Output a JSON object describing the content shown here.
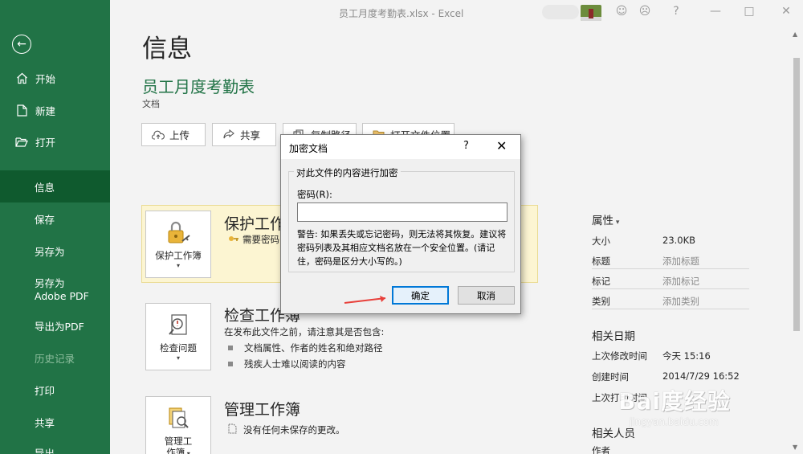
{
  "window": {
    "title": "员工月度考勤表.xlsx - Excel"
  },
  "sidebar": {
    "items": [
      {
        "label": "开始",
        "icon": "home-icon"
      },
      {
        "label": "新建",
        "icon": "new-file-icon"
      },
      {
        "label": "打开",
        "icon": "open-folder-icon"
      },
      {
        "label": "信息",
        "active": true
      },
      {
        "label": "保存"
      },
      {
        "label": "另存为"
      },
      {
        "label": "另存为 Adobe PDF"
      },
      {
        "label": "导出为PDF"
      },
      {
        "label": "历史记录",
        "disabled": true
      },
      {
        "label": "打印"
      },
      {
        "label": "共享"
      },
      {
        "label": "导出"
      }
    ]
  },
  "main": {
    "page_title": "信息",
    "doc_name": "员工月度考勤表",
    "doc_type": "文档",
    "actions": [
      "上传",
      "共享",
      "复制路径",
      "打开文件位置"
    ],
    "protect": {
      "button_label": "保护工作簿",
      "title": "保护工作",
      "desc": "需要密码"
    },
    "inspect": {
      "button_label": "检查问题",
      "title": "检查工作簿",
      "desc": "在发布此文件之前，请注意其是否包含:",
      "bullets": [
        "文档属性、作者的姓名和绝对路径",
        "残疾人士难以阅读的内容"
      ]
    },
    "manage": {
      "button_label_1": "管理工",
      "button_label_2": "作簿",
      "title": "管理工作簿",
      "desc": "没有任何未保存的更改。"
    }
  },
  "properties": {
    "header": "属性",
    "rows": [
      {
        "key": "大小",
        "value": "23.0KB"
      },
      {
        "key": "标题",
        "value": "添加标题"
      },
      {
        "key": "标记",
        "value": "添加标记"
      },
      {
        "key": "类别",
        "value": "添加类别"
      }
    ],
    "dates_header": "相关日期",
    "dates": [
      {
        "key": "上次修改时间",
        "value": "今天 15:16"
      },
      {
        "key": "创建时间",
        "value": "2014/7/29 16:52"
      },
      {
        "key": "上次打印时间",
        "value": ""
      }
    ],
    "people_header": "相关人员",
    "people": [
      {
        "key": "作者",
        "value": ""
      }
    ]
  },
  "dialog": {
    "title": "加密文档",
    "help": "?",
    "close": "✕",
    "group_label": "对此文件的内容进行加密",
    "password_label": "密码(R):",
    "password_value": "",
    "warning": "警告: 如果丢失或忘记密码，则无法将其恢复。建议将密码列表及其相应文档名放在一个安全位置。(请记住，密码是区分大小写的。)",
    "ok": "确定",
    "cancel": "取消"
  },
  "watermark": {
    "brand": "Bai度经验",
    "url": "jingyan.baidu.com"
  },
  "colors": {
    "accent": "#217346",
    "accent_dark": "#0f5a2e",
    "protect_bg": "#fcf5d2",
    "arrow": "#e8403a",
    "dialog_focus": "#0078d7"
  }
}
